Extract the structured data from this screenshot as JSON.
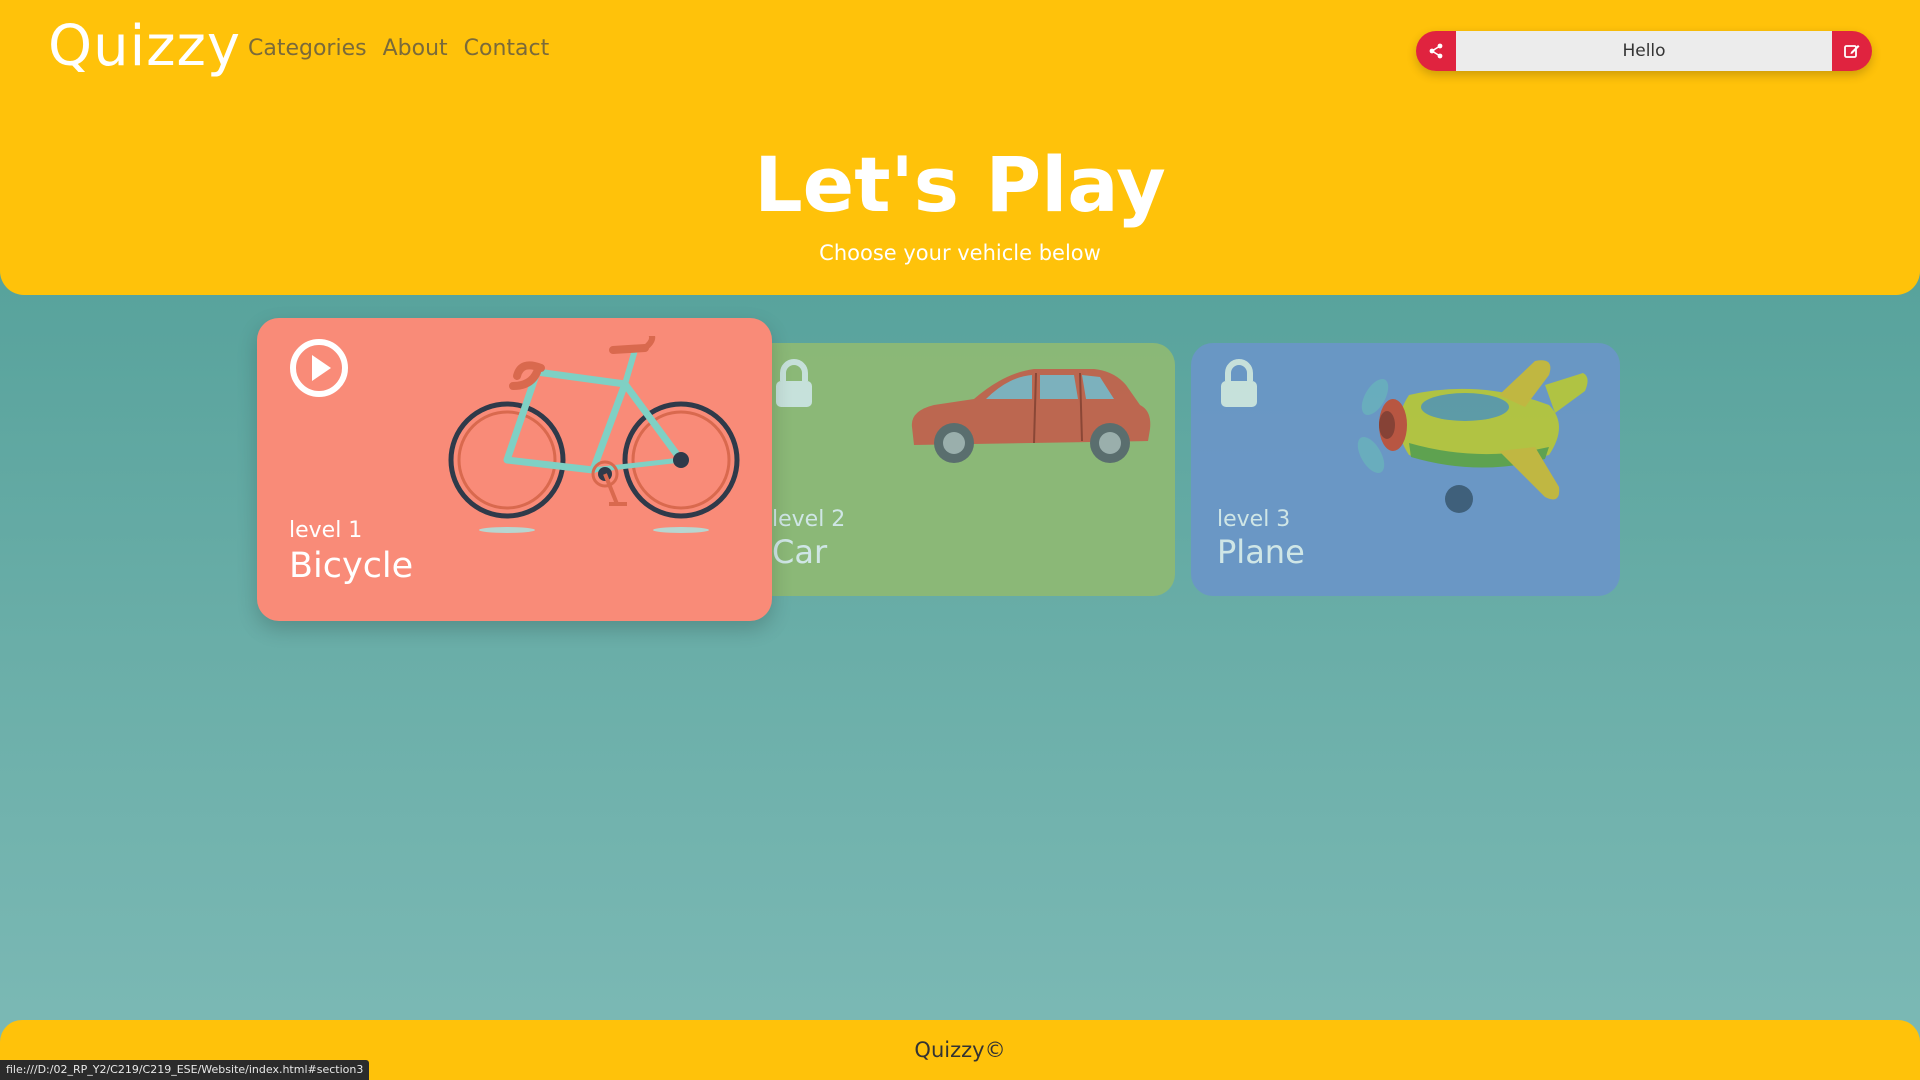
{
  "header": {
    "brand": "Quizzy",
    "nav": [
      "Categories",
      "About",
      "Contact"
    ],
    "user_input_value": "Hello",
    "share_icon": "share-icon",
    "edit_icon": "edit-icon"
  },
  "hero": {
    "title": "Let's Play",
    "subtitle": "Choose your vehicle below"
  },
  "cards": [
    {
      "level": "level 1",
      "name": "Bicycle",
      "state": "unlocked",
      "icon": "play-icon",
      "color": "#f98b78"
    },
    {
      "level": "level 2",
      "name": "Car",
      "state": "locked",
      "icon": "lock-icon",
      "color": "#8fba74"
    },
    {
      "level": "level 3",
      "name": "Plane",
      "state": "locked",
      "icon": "lock-icon",
      "color": "#6b96c8"
    }
  ],
  "footer": {
    "text": "Quizzy©"
  },
  "status_bar": {
    "url": "file:///D:/02_RP_Y2/C219/C219_ESE/Website/index.html#section3"
  },
  "colors": {
    "header_bg": "#ffc20a",
    "accent_red": "#e0233f"
  }
}
